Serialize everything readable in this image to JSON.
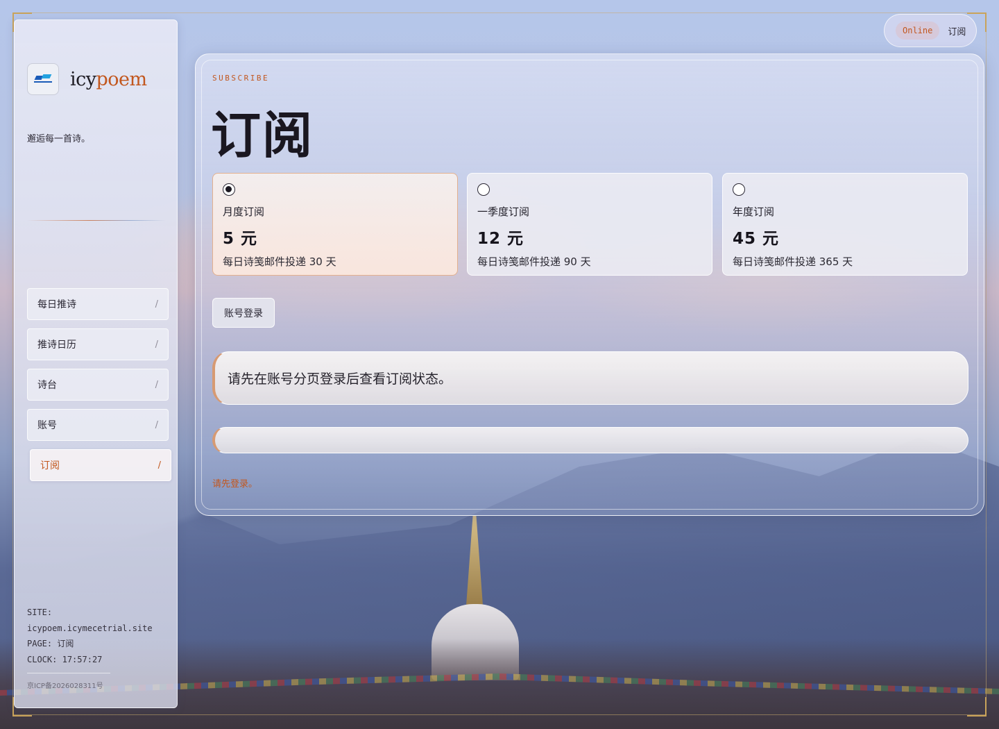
{
  "brand": {
    "name_part1": "icy",
    "name_part2": "poem",
    "logo_icon": "icymecetrial-logo-icon",
    "tagline": "邂逅每一首诗。"
  },
  "nav": {
    "items": [
      {
        "label": "每日推诗",
        "marker": "/"
      },
      {
        "label": "推诗日历",
        "marker": "/"
      },
      {
        "label": "诗台",
        "marker": "/"
      },
      {
        "label": "账号",
        "marker": "/"
      },
      {
        "label": "订阅",
        "marker": "/",
        "active": true
      }
    ]
  },
  "meta": {
    "site_label": "SITE:",
    "site_value": "icypoem.icymecetrial.site",
    "page_label": "PAGE:",
    "page_value": "订阅",
    "clock_label": "CLOCK:",
    "clock_value": "17:57:27",
    "icp": "京ICP备2026028311号"
  },
  "status": {
    "badge": "Online",
    "page": "订阅"
  },
  "main": {
    "eyebrow": "SUBSCRIBE",
    "title": "订阅",
    "plans": [
      {
        "name": "月度订阅",
        "price": "5 元",
        "desc": "每日诗笺邮件投递 30 天",
        "selected": true
      },
      {
        "name": "一季度订阅",
        "price": "12 元",
        "desc": "每日诗笺邮件投递 90 天",
        "selected": false
      },
      {
        "name": "年度订阅",
        "price": "45 元",
        "desc": "每日诗笺邮件投递 365 天",
        "selected": false
      }
    ],
    "login_button": "账号登录",
    "notice": "请先在账号分页登录后查看订阅状态。",
    "status_bar_text": "",
    "hint": "请先登录。"
  },
  "colors": {
    "accent": "#c2571e",
    "text": "#1a1720"
  }
}
